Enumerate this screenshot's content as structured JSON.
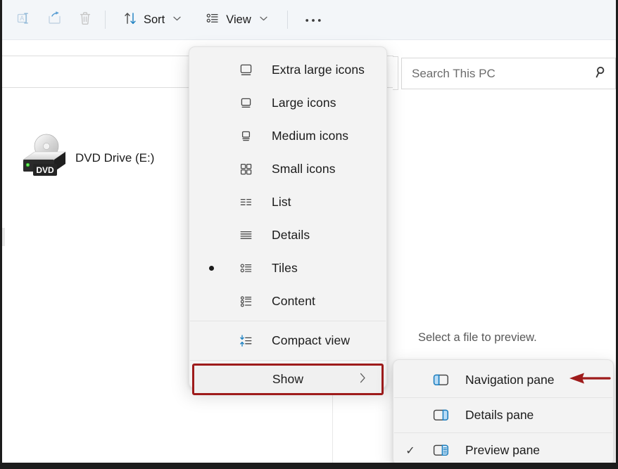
{
  "window": {
    "frame_color": "#1c1c1c",
    "toolbar_bg": "#f3f6f9",
    "accent_blue": "#0f6cbd",
    "highlight_red": "#9e1b1b"
  },
  "toolbar": {
    "items": [
      {
        "name": "rename-button",
        "icon": "rename-icon",
        "label": "",
        "disabled": true
      },
      {
        "name": "share-button",
        "icon": "share-icon",
        "label": "",
        "disabled": true
      },
      {
        "name": "delete-button",
        "icon": "trash-icon",
        "label": "",
        "disabled": true
      },
      {
        "name": "sort-button",
        "icon": "sort-icon",
        "label": "Sort",
        "disabled": false
      },
      {
        "name": "view-button",
        "icon": "view-icon",
        "label": "View",
        "disabled": false
      },
      {
        "name": "see-more-button",
        "icon": "ellipsis-icon",
        "label": "",
        "disabled": false
      }
    ],
    "sort_label": "Sort",
    "view_label": "View",
    "see_more_label": "•••",
    "chevron": "⌄"
  },
  "search": {
    "placeholder": "Search This PC",
    "icon": "search-icon"
  },
  "content": {
    "items": [
      {
        "name": "dvd-drive",
        "label": "DVD Drive (E:)",
        "icon": "dvd-drive-icon",
        "badge": "DVD"
      }
    ]
  },
  "preview_pane": {
    "message": "Select a file to preview."
  },
  "view_menu": {
    "items": [
      {
        "key": "extra-large-icons",
        "label": "Extra large icons",
        "icon": "monitor-large-icon",
        "selected": false
      },
      {
        "key": "large-icons",
        "label": "Large icons",
        "icon": "monitor-medium-icon",
        "selected": false
      },
      {
        "key": "medium-icons",
        "label": "Medium icons",
        "icon": "monitor-small-icon",
        "selected": false
      },
      {
        "key": "small-icons",
        "label": "Small icons",
        "icon": "grid-four-icon",
        "selected": false
      },
      {
        "key": "list",
        "label": "List",
        "icon": "list-columns-icon",
        "selected": false
      },
      {
        "key": "details",
        "label": "Details",
        "icon": "details-lines-icon",
        "selected": false
      },
      {
        "key": "tiles",
        "label": "Tiles",
        "icon": "tiles-icon",
        "selected": true
      },
      {
        "key": "content",
        "label": "Content",
        "icon": "content-icon",
        "selected": false
      }
    ],
    "compact_view": {
      "label": "Compact view",
      "icon": "compact-view-icon"
    },
    "show": {
      "label": "Show",
      "icon": "submenu-chevron-icon",
      "chevron": "›",
      "highlighted": true
    }
  },
  "show_submenu": {
    "items": [
      {
        "key": "navigation-pane",
        "label": "Navigation pane",
        "icon": "navigation-pane-icon",
        "checked": false
      },
      {
        "key": "details-pane",
        "label": "Details pane",
        "icon": "details-pane-icon",
        "checked": false
      },
      {
        "key": "preview-pane",
        "label": "Preview pane",
        "icon": "preview-pane-icon",
        "checked": true
      }
    ],
    "check_glyph": "✓"
  },
  "annotation": {
    "arrow": {
      "name": "red-pointer-arrow",
      "color": "#9e1b1b",
      "points_to": "Navigation pane"
    },
    "box": {
      "name": "red-highlight-box",
      "color": "#9e1b1b",
      "around": "Show"
    }
  }
}
